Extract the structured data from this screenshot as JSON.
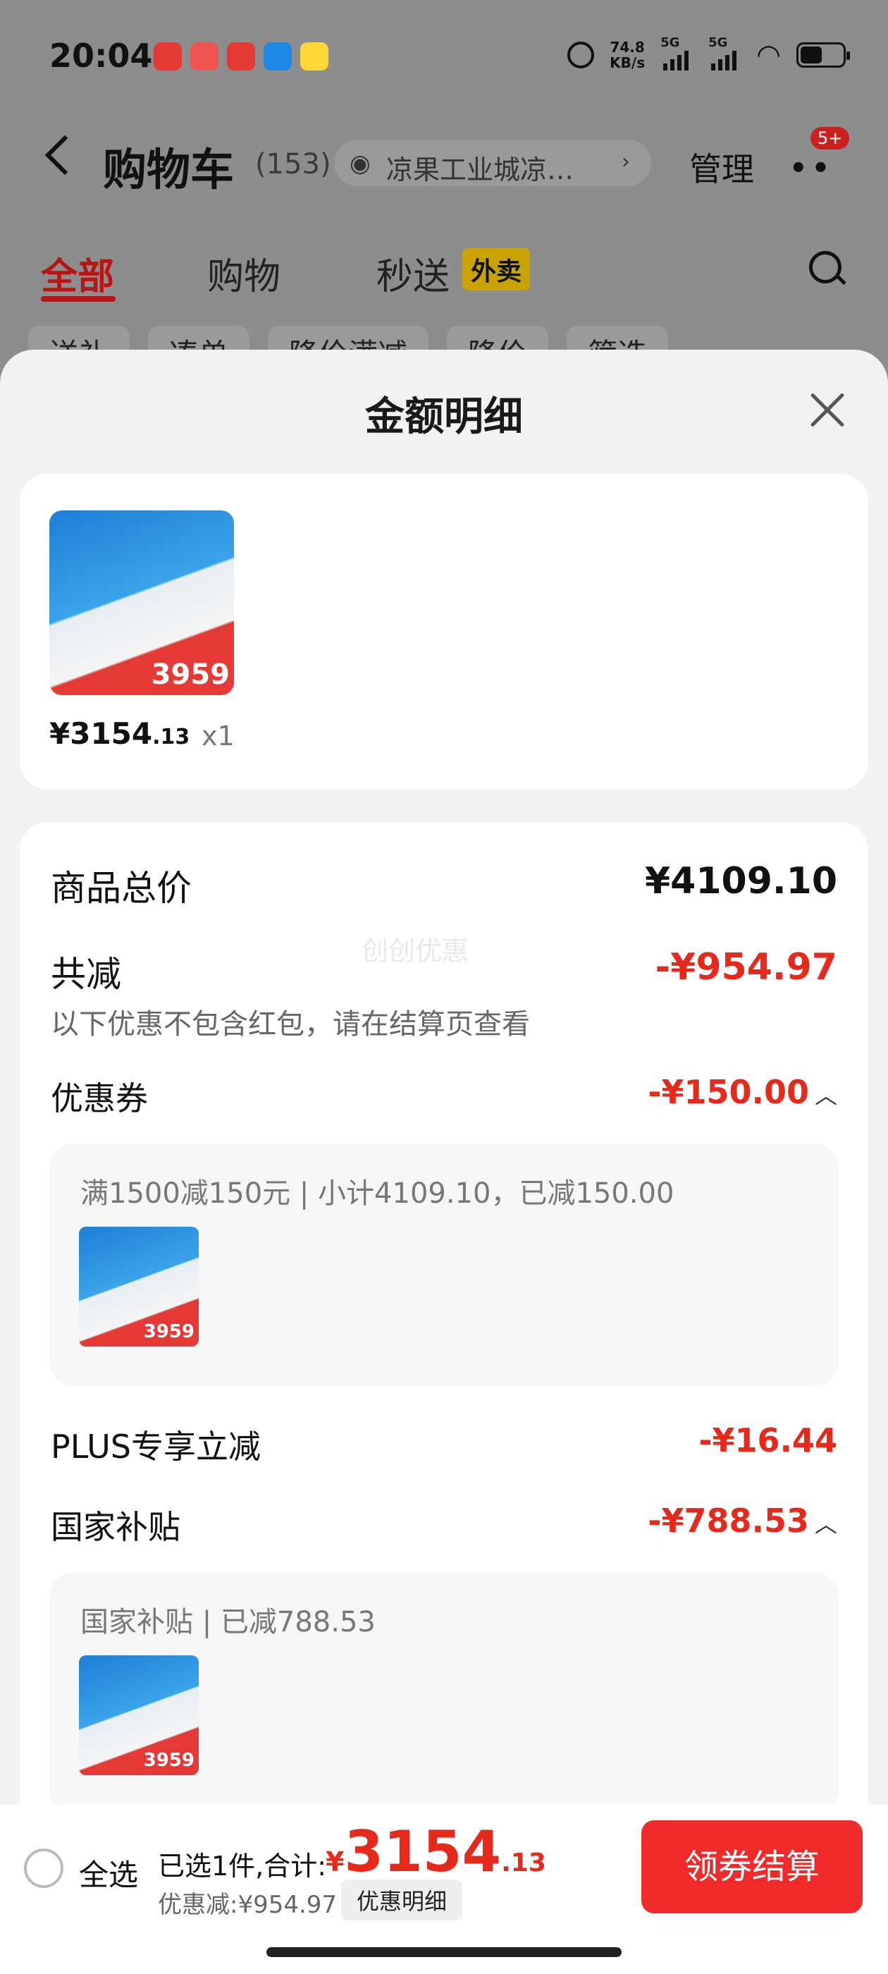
{
  "status": {
    "time": "20:04",
    "net_speed_top": "74.8",
    "net_speed_bottom": "KB/s",
    "sim1": "5G",
    "sim2": "5G",
    "app_colors": [
      "#e53935",
      "#e53935",
      "#e53935",
      "#1e88e5",
      "#fdd835"
    ]
  },
  "header": {
    "title": "购物车",
    "count": "(153)",
    "address": "凉果工业城凉…",
    "manage": "管理",
    "badge": "5+"
  },
  "tabs": {
    "all": "全部",
    "shopping": "购物",
    "seconds": "秒送",
    "takeout": "外卖"
  },
  "chips": [
    "送礼",
    "凑单",
    "降价满减",
    "降价",
    "筛选"
  ],
  "sheet": {
    "title": "金额明细",
    "product": {
      "image_price_label": "3959",
      "price_int": "¥3154",
      "price_dec": ".13",
      "qty": "x1"
    },
    "watermark": "创创优惠",
    "rows": {
      "total_label": "商品总价",
      "total_value": "¥4109.10",
      "reduce_label": "共减",
      "reduce_value": "-¥954.97",
      "reduce_note": "以下优惠不包含红包，请在结算页查看",
      "coupon_label": "优惠券",
      "coupon_value": "-¥150.00",
      "coupon_detail": "满1500减150元 | 小计4109.10，已减150.00",
      "plus_label": "PLUS专享立减",
      "plus_value": "-¥16.44",
      "subsidy_label": "国家补贴",
      "subsidy_value": "-¥788.53",
      "subsidy_detail": "国家补贴 | 已减788.53"
    }
  },
  "bottom": {
    "select_all": "全选",
    "selected": "已选1件,合计:",
    "total_currency": "¥",
    "total_int": "3154",
    "total_dec": ".13",
    "discount": "优惠减:¥954.97",
    "discount_button": "优惠明细",
    "checkout": "领券结算"
  },
  "colors": {
    "accent_red": "#e52a1c",
    "checkout_red": "#f02a2a"
  }
}
